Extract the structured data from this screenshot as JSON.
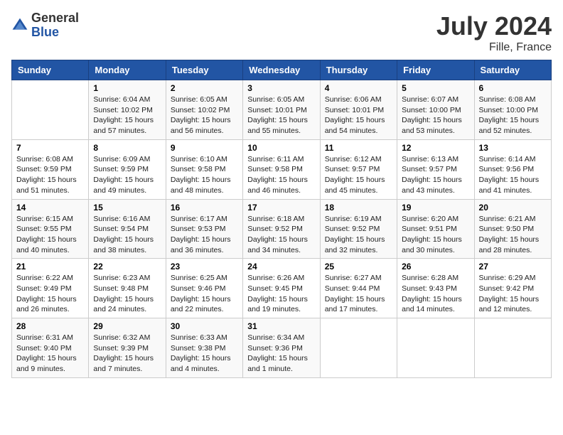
{
  "header": {
    "logo_general": "General",
    "logo_blue": "Blue",
    "title": "July 2024",
    "location": "Fille, France"
  },
  "calendar": {
    "days_of_week": [
      "Sunday",
      "Monday",
      "Tuesday",
      "Wednesday",
      "Thursday",
      "Friday",
      "Saturday"
    ],
    "weeks": [
      [
        {
          "num": "",
          "info": ""
        },
        {
          "num": "1",
          "info": "Sunrise: 6:04 AM\nSunset: 10:02 PM\nDaylight: 15 hours\nand 57 minutes."
        },
        {
          "num": "2",
          "info": "Sunrise: 6:05 AM\nSunset: 10:02 PM\nDaylight: 15 hours\nand 56 minutes."
        },
        {
          "num": "3",
          "info": "Sunrise: 6:05 AM\nSunset: 10:01 PM\nDaylight: 15 hours\nand 55 minutes."
        },
        {
          "num": "4",
          "info": "Sunrise: 6:06 AM\nSunset: 10:01 PM\nDaylight: 15 hours\nand 54 minutes."
        },
        {
          "num": "5",
          "info": "Sunrise: 6:07 AM\nSunset: 10:00 PM\nDaylight: 15 hours\nand 53 minutes."
        },
        {
          "num": "6",
          "info": "Sunrise: 6:08 AM\nSunset: 10:00 PM\nDaylight: 15 hours\nand 52 minutes."
        }
      ],
      [
        {
          "num": "7",
          "info": "Sunrise: 6:08 AM\nSunset: 9:59 PM\nDaylight: 15 hours\nand 51 minutes."
        },
        {
          "num": "8",
          "info": "Sunrise: 6:09 AM\nSunset: 9:59 PM\nDaylight: 15 hours\nand 49 minutes."
        },
        {
          "num": "9",
          "info": "Sunrise: 6:10 AM\nSunset: 9:58 PM\nDaylight: 15 hours\nand 48 minutes."
        },
        {
          "num": "10",
          "info": "Sunrise: 6:11 AM\nSunset: 9:58 PM\nDaylight: 15 hours\nand 46 minutes."
        },
        {
          "num": "11",
          "info": "Sunrise: 6:12 AM\nSunset: 9:57 PM\nDaylight: 15 hours\nand 45 minutes."
        },
        {
          "num": "12",
          "info": "Sunrise: 6:13 AM\nSunset: 9:57 PM\nDaylight: 15 hours\nand 43 minutes."
        },
        {
          "num": "13",
          "info": "Sunrise: 6:14 AM\nSunset: 9:56 PM\nDaylight: 15 hours\nand 41 minutes."
        }
      ],
      [
        {
          "num": "14",
          "info": "Sunrise: 6:15 AM\nSunset: 9:55 PM\nDaylight: 15 hours\nand 40 minutes."
        },
        {
          "num": "15",
          "info": "Sunrise: 6:16 AM\nSunset: 9:54 PM\nDaylight: 15 hours\nand 38 minutes."
        },
        {
          "num": "16",
          "info": "Sunrise: 6:17 AM\nSunset: 9:53 PM\nDaylight: 15 hours\nand 36 minutes."
        },
        {
          "num": "17",
          "info": "Sunrise: 6:18 AM\nSunset: 9:52 PM\nDaylight: 15 hours\nand 34 minutes."
        },
        {
          "num": "18",
          "info": "Sunrise: 6:19 AM\nSunset: 9:52 PM\nDaylight: 15 hours\nand 32 minutes."
        },
        {
          "num": "19",
          "info": "Sunrise: 6:20 AM\nSunset: 9:51 PM\nDaylight: 15 hours\nand 30 minutes."
        },
        {
          "num": "20",
          "info": "Sunrise: 6:21 AM\nSunset: 9:50 PM\nDaylight: 15 hours\nand 28 minutes."
        }
      ],
      [
        {
          "num": "21",
          "info": "Sunrise: 6:22 AM\nSunset: 9:49 PM\nDaylight: 15 hours\nand 26 minutes."
        },
        {
          "num": "22",
          "info": "Sunrise: 6:23 AM\nSunset: 9:48 PM\nDaylight: 15 hours\nand 24 minutes."
        },
        {
          "num": "23",
          "info": "Sunrise: 6:25 AM\nSunset: 9:46 PM\nDaylight: 15 hours\nand 22 minutes."
        },
        {
          "num": "24",
          "info": "Sunrise: 6:26 AM\nSunset: 9:45 PM\nDaylight: 15 hours\nand 19 minutes."
        },
        {
          "num": "25",
          "info": "Sunrise: 6:27 AM\nSunset: 9:44 PM\nDaylight: 15 hours\nand 17 minutes."
        },
        {
          "num": "26",
          "info": "Sunrise: 6:28 AM\nSunset: 9:43 PM\nDaylight: 15 hours\nand 14 minutes."
        },
        {
          "num": "27",
          "info": "Sunrise: 6:29 AM\nSunset: 9:42 PM\nDaylight: 15 hours\nand 12 minutes."
        }
      ],
      [
        {
          "num": "28",
          "info": "Sunrise: 6:31 AM\nSunset: 9:40 PM\nDaylight: 15 hours\nand 9 minutes."
        },
        {
          "num": "29",
          "info": "Sunrise: 6:32 AM\nSunset: 9:39 PM\nDaylight: 15 hours\nand 7 minutes."
        },
        {
          "num": "30",
          "info": "Sunrise: 6:33 AM\nSunset: 9:38 PM\nDaylight: 15 hours\nand 4 minutes."
        },
        {
          "num": "31",
          "info": "Sunrise: 6:34 AM\nSunset: 9:36 PM\nDaylight: 15 hours\nand 1 minute."
        },
        {
          "num": "",
          "info": ""
        },
        {
          "num": "",
          "info": ""
        },
        {
          "num": "",
          "info": ""
        }
      ]
    ]
  }
}
